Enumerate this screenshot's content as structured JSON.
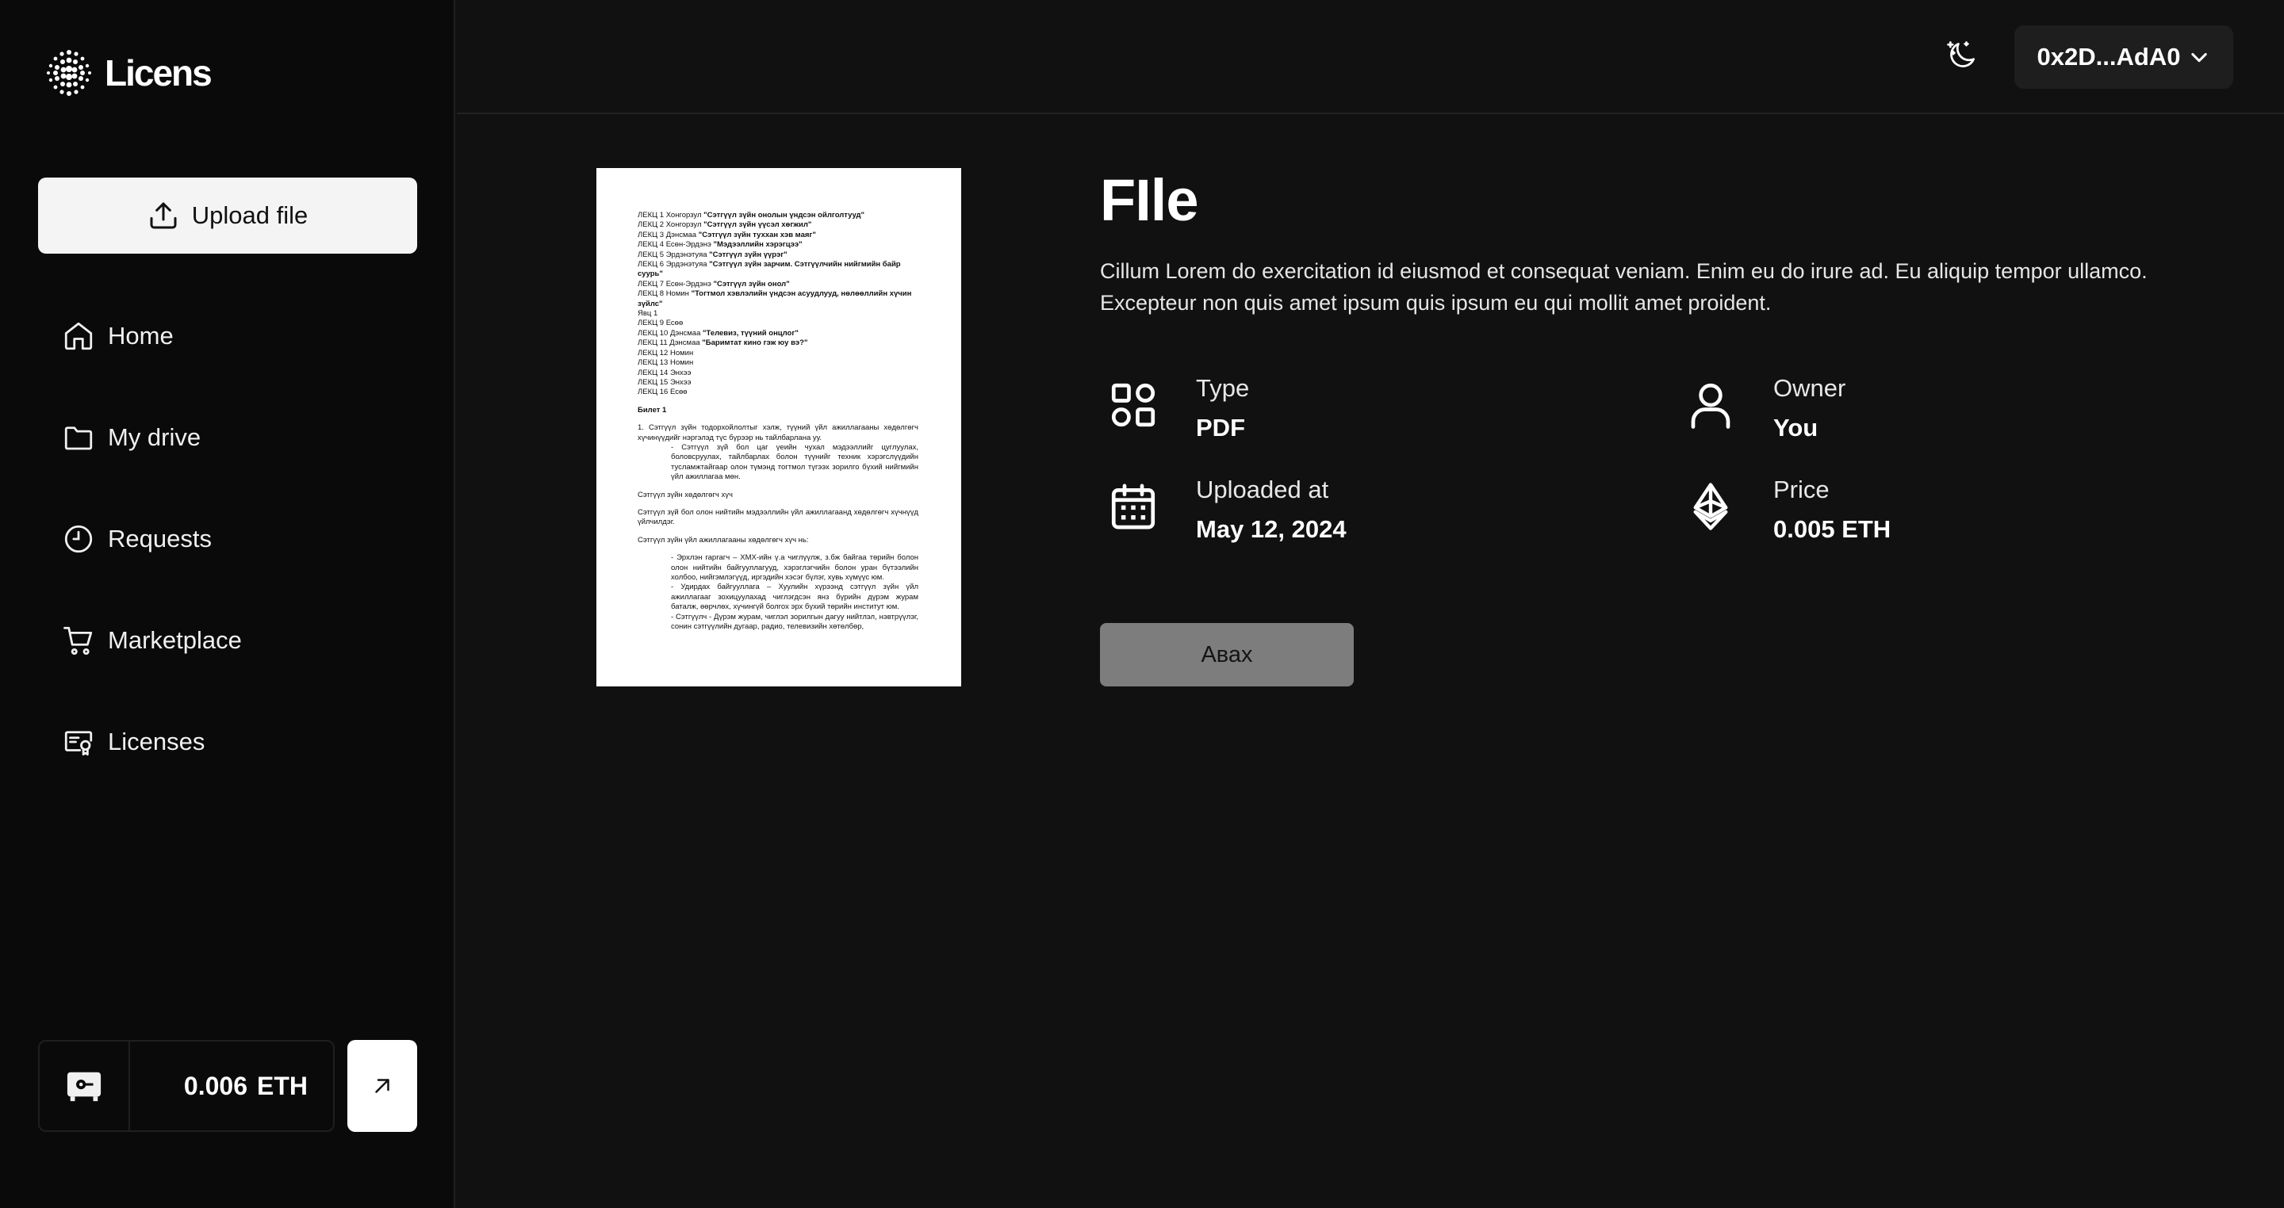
{
  "app": {
    "name": "Licens"
  },
  "sidebar": {
    "upload_label": "Upload file",
    "items": [
      {
        "label": "Home",
        "icon": "home-icon"
      },
      {
        "label": "My drive",
        "icon": "folder-icon"
      },
      {
        "label": "Requests",
        "icon": "clock-icon"
      },
      {
        "label": "Marketplace",
        "icon": "cart-icon"
      },
      {
        "label": "Licenses",
        "icon": "license-icon"
      }
    ],
    "wallet": {
      "amount": "0.006",
      "unit": "ETH"
    }
  },
  "header": {
    "account": "0x2D...AdA0"
  },
  "file": {
    "title": "FIle",
    "description": "Cillum Lorem do exercitation id eiusmod et consequat veniam. Enim eu do irure ad. Eu aliquip tempor ullamco. Excepteur non quis amet ipsum quis ipsum eu qui mollit amet proident.",
    "type_label": "Type",
    "type_value": "PDF",
    "uploaded_label": "Uploaded at",
    "uploaded_value": "May 12, 2024",
    "owner_label": "Owner",
    "owner_value": "You",
    "price_label": "Price",
    "price_value": "0.005 ETH",
    "action_label": "Авах"
  },
  "preview": {
    "lines": [
      {
        "pre": "ЛЕКЦ 1 Хонгорзул ",
        "bold": "\"Сэтгүүл зүйн онолын үндсэн ойлголтууд\""
      },
      {
        "pre": "ЛЕКЦ 2 Хонгорзул ",
        "bold": "\"Сэтгүүл зүйн үүсэл хөгжил\""
      },
      {
        "pre": "ЛЕКЦ 3 Дэнсмаа ",
        "bold": "\"Сэтгүүл зүйн туххан хэв маяг\""
      },
      {
        "pre": "ЛЕКЦ 4 Есөн-Эрдэнэ ",
        "bold": "\"Мэдээллийн хэрэгцээ\""
      },
      {
        "pre": "ЛЕКЦ 5 Эрдэнэтуяа ",
        "bold": "\"Сэтгүүл зүйн үүрэг\""
      },
      {
        "pre": "ЛЕКЦ 6 Эрдэнэтуяа ",
        "bold": "\"Сэтгүүл зүйн зарчим. Сэтгүүлчийн нийгмийн байр"
      },
      {
        "pre": "",
        "bold": "суурь\""
      },
      {
        "pre": "ЛЕКЦ 7 Есөн-Эрдэнэ ",
        "bold": "\"Сэтгүүл зүйн онол\""
      },
      {
        "pre": "ЛЕКЦ 8 Номин ",
        "bold": "\"Тогтмол хэвлэлийн үндсэн асуудлууд, нөлөөллийн хүчин"
      },
      {
        "pre": "",
        "bold": "зүйлс\""
      },
      {
        "pre": "Явц 1",
        "bold": ""
      },
      {
        "pre": "ЛЕКЦ 9 Есөө",
        "bold": ""
      },
      {
        "pre": "ЛЕКЦ 10 Дэнсмаа ",
        "bold": "\"Телевиз, түүний онцлог\""
      },
      {
        "pre": "ЛЕКЦ 11 Дэнсмаа ",
        "bold": "\"Баримтат кино гэж юу вэ?\""
      },
      {
        "pre": "ЛЕКЦ 12 Номин",
        "bold": ""
      },
      {
        "pre": "ЛЕКЦ 13 Номин",
        "bold": ""
      },
      {
        "pre": "ЛЕКЦ 14 Энхээ",
        "bold": ""
      },
      {
        "pre": "ЛЕКЦ 15 Энхээ",
        "bold": ""
      },
      {
        "pre": "ЛЕКЦ 16 Есөө",
        "bold": ""
      }
    ],
    "ticket": "Билет 1",
    "q1": "1.      Сэтгүүл зүйн тодорхойлолтыг хэлж, түүний үйл ажиллагааны хөдөлгөгч хүчинүүдийг нэргэлэд түс бүрээр нь тайлбарлана уу.",
    "q1_sub": "-        Сэтгүүл зүй бол цаг үеийн чухал мэдээллийг цуглуулах, боловсруулах, тайлбарлах болон түүнийг техник хэрэгслүүдийн тусламжтайгаар олон түмэнд тогтмол түгээх зорилго бүхий нийгмийн үйл ажиллагаа мөн.",
    "p1": "Сэтгүүл зүйн хөдөлгөгч хүч",
    "p2": "Сэтгүүл зүй бол олон нийтийн мэдээллийн үйл ажиллагаанд хөдөлгөгч хүчнүүд үйлчилдэг.",
    "p3": "Сэтгүүл зүйн үйл ажиллагааны хөдөлгөгч хүч нь:",
    "b1": "-     Эрхлэн гаргагч – ХМХ-ийн ү.а чиглүүлж, з.бж байгаа төрийн болон олон нийтийн байгууллагууд, хэрэглэгчийн болон уран бүтээлийн холбоо, нийгэмлэгүүд, иргэдийн хэсэг бүлэг, хувь хүмүүс юм.",
    "b2": "-     Удирдах байгууллага – Хуулийн хүрээнд сэтгүүл зүйн үйл ажиллагааг зохицуулахад чиглэгдсэн янз бүрийн дүрэм журам баталж, өөрчлөх, хүчингүй болгох эрх бүхий төрийн институт юм.",
    "b3": "-     Сэтгүүлч - Дүрэм журам, чиглэл зорилгын дагуу нийтлэл, нэвтрүүлэг, сонин сэтгүүлийн дугаар, радио, телевизийн хөтөлбөр,"
  }
}
